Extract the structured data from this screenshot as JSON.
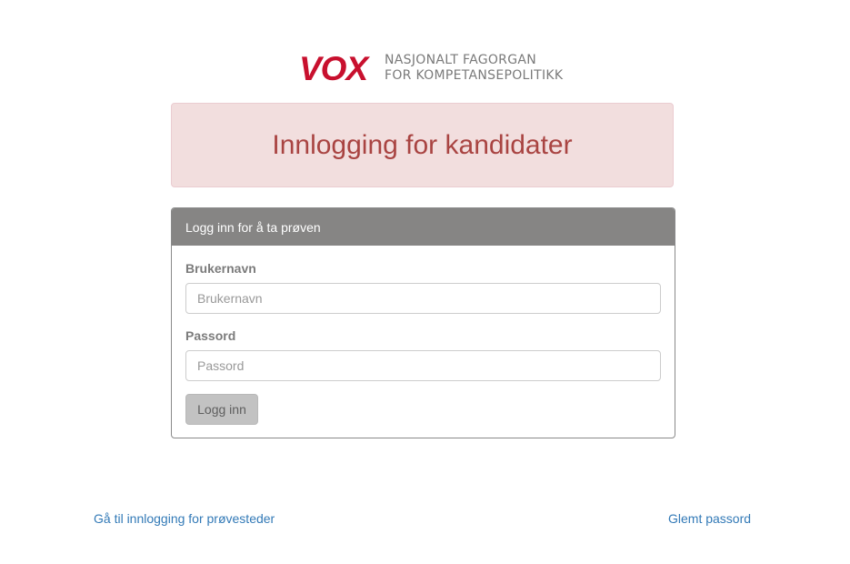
{
  "logo": {
    "brand": "VOX",
    "line1": "NASJONALT FAGORGAN",
    "line2": "FOR KOMPETANSEPOLITIKK",
    "brand_color": "#c8102e"
  },
  "banner": {
    "title": "Innlogging for kandidater"
  },
  "panel": {
    "heading": "Logg inn for å ta prøven",
    "username_label": "Brukernavn",
    "username_placeholder": "Brukernavn",
    "username_value": "",
    "password_label": "Passord",
    "password_placeholder": "Passord",
    "password_value": "",
    "submit_label": "Logg inn"
  },
  "footer": {
    "left_link": "Gå til innlogging for prøvesteder",
    "right_link": "Glemt passord"
  },
  "colors": {
    "alert_bg": "#f2dede",
    "alert_text": "#a94442",
    "panel_heading_bg": "#868584",
    "link": "#337ab7"
  }
}
